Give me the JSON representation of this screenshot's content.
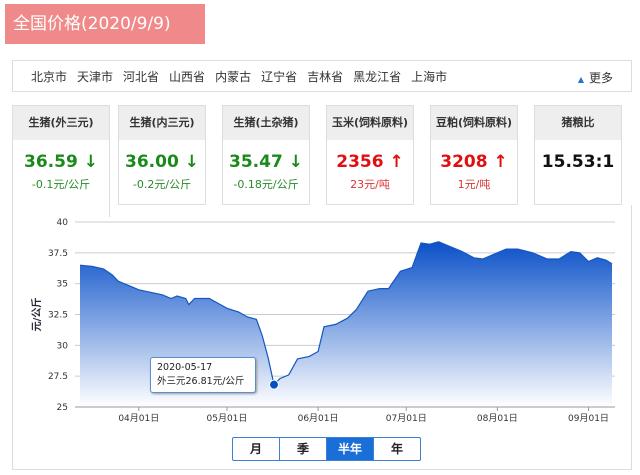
{
  "title": "全国价格(2020/9/9)",
  "cities": [
    "北京市",
    "天津市",
    "河北省",
    "山西省",
    "内蒙古",
    "辽宁省",
    "吉林省",
    "黑龙江省",
    "上海市"
  ],
  "more_label": "更多",
  "cards": [
    {
      "label": "生猪(外三元)",
      "value": "36.59",
      "arrow": "↓",
      "change": "-0.1元/公斤",
      "trend": "down"
    },
    {
      "label": "生猪(内三元)",
      "value": "36.00",
      "arrow": "↓",
      "change": "-0.2元/公斤",
      "trend": "down"
    },
    {
      "label": "生猪(土杂猪)",
      "value": "35.47",
      "arrow": "↓",
      "change": "-0.18元/公斤",
      "trend": "down"
    },
    {
      "label": "玉米(饲料原料)",
      "value": "2356",
      "arrow": "↑",
      "change": "23元/吨",
      "trend": "up"
    },
    {
      "label": "豆粕(饲料原料)",
      "value": "3208",
      "arrow": "↑",
      "change": "1元/吨",
      "trend": "up"
    },
    {
      "label": "猪粮比",
      "value": "15.53:1",
      "arrow": "",
      "change": "",
      "trend": "none"
    }
  ],
  "tooltip": {
    "date": "2020-05-17",
    "text": "外三元26.81元/公斤"
  },
  "range_buttons": [
    "月",
    "季",
    "半年",
    "年"
  ],
  "active_range": "半年",
  "chart_data": {
    "type": "area",
    "ylabel": "元/公斤",
    "ylim": [
      25,
      40
    ],
    "yticks": [
      "25",
      "27.5",
      "30",
      "32.5",
      "35",
      "37.5",
      "40"
    ],
    "xticks": [
      {
        "date": "2020-04-01",
        "label": "04月01日"
      },
      {
        "date": "2020-05-01",
        "label": "05月01日"
      },
      {
        "date": "2020-06-01",
        "label": "06月01日"
      },
      {
        "date": "2020-07-01",
        "label": "07月01日"
      },
      {
        "date": "2020-08-01",
        "label": "08月01日"
      },
      {
        "date": "2020-09-01",
        "label": "09月01日"
      }
    ],
    "xrange": [
      "2020-03-12",
      "2020-09-09"
    ],
    "points": [
      [
        "2020-03-12",
        36.5
      ],
      [
        "2020-03-16",
        36.4
      ],
      [
        "2020-03-20",
        36.2
      ],
      [
        "2020-03-23",
        35.7
      ],
      [
        "2020-03-25",
        35.2
      ],
      [
        "2020-03-29",
        34.8
      ],
      [
        "2020-04-01",
        34.5
      ],
      [
        "2020-04-05",
        34.3
      ],
      [
        "2020-04-09",
        34.1
      ],
      [
        "2020-04-12",
        33.8
      ],
      [
        "2020-04-14",
        34.0
      ],
      [
        "2020-04-17",
        33.8
      ],
      [
        "2020-04-18",
        33.3
      ],
      [
        "2020-04-20",
        33.8
      ],
      [
        "2020-04-25",
        33.8
      ],
      [
        "2020-04-28",
        33.4
      ],
      [
        "2020-05-01",
        33.0
      ],
      [
        "2020-05-05",
        32.7
      ],
      [
        "2020-05-08",
        32.3
      ],
      [
        "2020-05-11",
        32.1
      ],
      [
        "2020-05-13",
        30.8
      ],
      [
        "2020-05-15",
        29.0
      ],
      [
        "2020-05-17",
        26.81
      ],
      [
        "2020-05-19",
        27.3
      ],
      [
        "2020-05-22",
        27.6
      ],
      [
        "2020-05-25",
        28.9
      ],
      [
        "2020-05-29",
        29.1
      ],
      [
        "2020-06-01",
        29.5
      ],
      [
        "2020-06-03",
        31.5
      ],
      [
        "2020-06-07",
        31.7
      ],
      [
        "2020-06-11",
        32.2
      ],
      [
        "2020-06-14",
        32.9
      ],
      [
        "2020-06-18",
        34.4
      ],
      [
        "2020-06-22",
        34.6
      ],
      [
        "2020-06-25",
        34.6
      ],
      [
        "2020-06-29",
        36.0
      ],
      [
        "2020-07-03",
        36.3
      ],
      [
        "2020-07-06",
        38.3
      ],
      [
        "2020-07-09",
        38.2
      ],
      [
        "2020-07-12",
        38.4
      ],
      [
        "2020-07-16",
        38.0
      ],
      [
        "2020-07-20",
        37.6
      ],
      [
        "2020-07-24",
        37.1
      ],
      [
        "2020-07-27",
        37.0
      ],
      [
        "2020-07-31",
        37.4
      ],
      [
        "2020-08-04",
        37.8
      ],
      [
        "2020-08-08",
        37.8
      ],
      [
        "2020-08-13",
        37.5
      ],
      [
        "2020-08-18",
        37.0
      ],
      [
        "2020-08-22",
        37.0
      ],
      [
        "2020-08-26",
        37.6
      ],
      [
        "2020-08-29",
        37.5
      ],
      [
        "2020-09-01",
        36.8
      ],
      [
        "2020-09-04",
        37.1
      ],
      [
        "2020-09-07",
        36.9
      ],
      [
        "2020-09-09",
        36.6
      ]
    ],
    "highlight": {
      "date": "2020-05-17",
      "value": 26.81
    }
  },
  "colors": {
    "up": "#e01010",
    "down": "#1a8a1a",
    "area_top": "#0a50c8",
    "area_bottom": "#ffffff",
    "active_button": "#1a6ed8"
  }
}
